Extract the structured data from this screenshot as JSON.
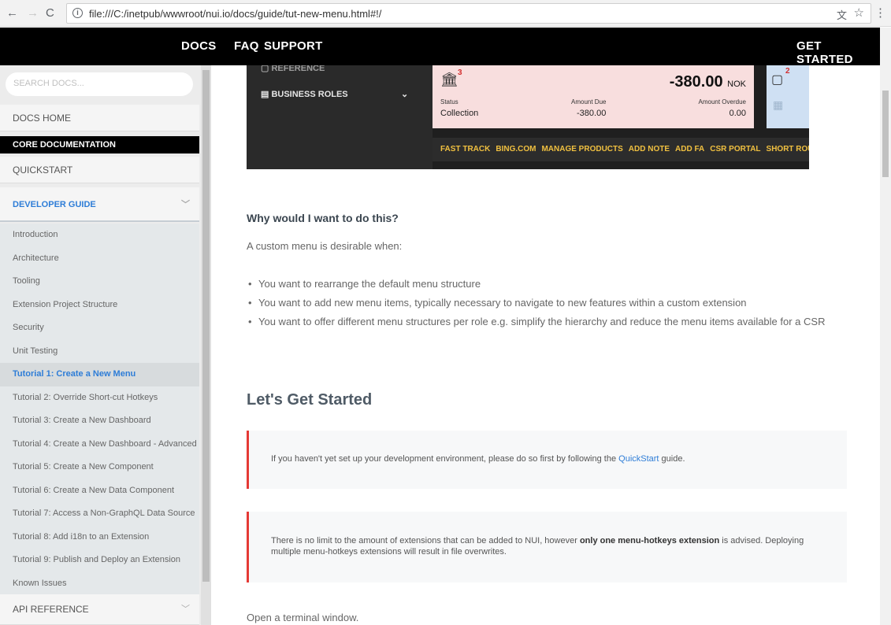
{
  "browser": {
    "url": "file:///C:/inetpub/wwwroot/nui.io/docs/guide/tut-new-menu.html#!/"
  },
  "topnav": {
    "docs": "DOCS",
    "faq": "FAQ",
    "support": "SUPPORT",
    "get_started": "GET STARTED"
  },
  "sidebar": {
    "search_placeholder": "SEARCH DOCS...",
    "docs_home": "DOCS HOME",
    "core_documentation": "CORE DOCUMENTATION",
    "quickstart": "QUICKSTART",
    "developer_guide": "DEVELOPER GUIDE",
    "items": [
      "Introduction",
      "Architecture",
      "Tooling",
      "Extension Project Structure",
      "Security",
      "Unit Testing",
      "Tutorial 1: Create a New Menu",
      "Tutorial 2: Override Short-cut Hotkeys",
      "Tutorial 3: Create a New Dashboard",
      "Tutorial 4: Create a New Dashboard - Advanced",
      "Tutorial 5: Create a New Component",
      "Tutorial 6: Create a New Data Component",
      "Tutorial 7: Access a Non-GraphQL Data Source",
      "Tutorial 8: Add i18n to an Extension",
      "Tutorial 9: Publish and Deploy an Extension",
      "Known Issues"
    ],
    "active_index": 6,
    "api_reference": "API REFERENCE"
  },
  "screenshot": {
    "menu_reference": "REFERENCE",
    "menu_business_roles": "BUSINESS ROLES",
    "badge_count": "3",
    "amount": "-380.00",
    "currency": "NOK",
    "status_label": "Status",
    "status_value": "Collection",
    "amount_due_label": "Amount Due",
    "amount_due_value": "-380.00",
    "amount_overdue_label": "Amount Overdue",
    "amount_overdue_value": "0.00",
    "blue_badge": "2",
    "shortcuts": [
      "FAST TRACK",
      "BING.COM",
      "MANAGE PRODUCTS",
      "ADD NOTE",
      "ADD FA",
      "CSR PORTAL",
      "SHORT ROU"
    ]
  },
  "content": {
    "why_heading": "Why would I want to do this?",
    "why_intro": "A custom menu is desirable when:",
    "bullets": [
      "You want to rearrange the default menu structure",
      "You want to add new menu items, typically necessary to navigate to new features within a custom extension",
      "You want to offer different menu structures per role e.g. simplify the hierarchy and reduce the menu items available for a CSR"
    ],
    "started_heading": "Let's Get Started",
    "callout1_before": "If you haven't yet set up your development environment, please do so first by following the ",
    "callout1_link": "QuickStart",
    "callout1_after": " guide.",
    "callout2_before": "There is no limit to the amount of extensions that can be added to NUI, however ",
    "callout2_bold": "only one menu-hotkeys extension",
    "callout2_after": " is advised. Deploying multiple menu-hotkeys extensions will result in file overwrites.",
    "terminal": "Open a terminal window."
  }
}
